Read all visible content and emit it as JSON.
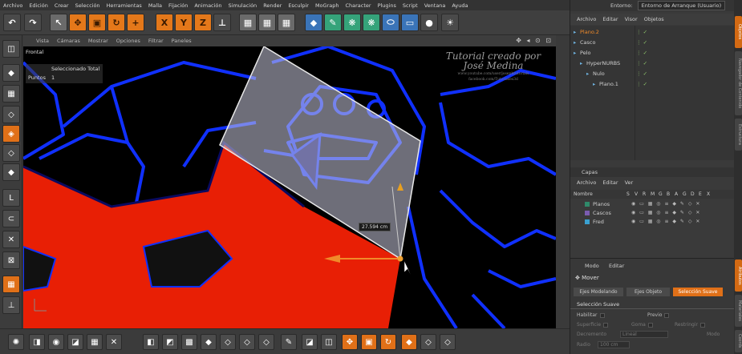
{
  "menubar": [
    "Archivo",
    "Edición",
    "Crear",
    "Selección",
    "Herramientas",
    "Malla",
    "Fijación",
    "Animación",
    "Simulación",
    "Render",
    "Esculpir",
    "MoGraph",
    "Character",
    "Plugins",
    "Script",
    "Ventana",
    "Ayuda"
  ],
  "toolbar": {
    "axis_x": "X",
    "axis_y": "Y",
    "axis_z": "Z"
  },
  "viewport": {
    "menu": [
      "Vista",
      "Cámaras",
      "Mostrar",
      "Opciones",
      "Filtrar",
      "Paneles"
    ],
    "view_name": "Frontal",
    "hud_title": "Seleccionado Total",
    "hud_label": "Puntos",
    "hud_value": "1",
    "watermark_line1": "Tutorial creado por",
    "watermark_line2": "José Medina",
    "watermark_line3": "www.youtube.com/user/josephtutorials",
    "watermark_line4": "facebook.com/Tutoriales3d",
    "measure": "27.594 cm"
  },
  "entorno": {
    "label": "Entorno:",
    "value": "Entorno de Arranque (Usuario)"
  },
  "objects": {
    "menu": [
      "Archivo",
      "Editar",
      "Visor",
      "Objetos"
    ],
    "rows": [
      {
        "name": "Plano.2",
        "indent": 0,
        "selected": true
      },
      {
        "name": "Casco",
        "indent": 0,
        "selected": false
      },
      {
        "name": "Pelo",
        "indent": 0,
        "selected": false
      },
      {
        "name": "HyperNURBS",
        "indent": 1,
        "selected": false
      },
      {
        "name": "Nulo",
        "indent": 2,
        "selected": false
      },
      {
        "name": "Plano.1",
        "indent": 3,
        "selected": false
      }
    ]
  },
  "layers": {
    "title": "Capas",
    "menu": [
      "Archivo",
      "Editar",
      "Ver"
    ],
    "columns": [
      "Nombre",
      "S",
      "V",
      "R",
      "M",
      "G",
      "B",
      "A",
      "G",
      "D",
      "E",
      "X"
    ],
    "rows": [
      {
        "name": "Planos",
        "color": "#2f8a6a"
      },
      {
        "name": "Cascos",
        "color": "#7a5cb0"
      },
      {
        "name": "Fred",
        "color": "#3aa0d0"
      }
    ]
  },
  "attributes": {
    "menu": [
      "Modo",
      "Editar"
    ],
    "mode_title": "Mover",
    "tabs": [
      "Ejes Modelando",
      "Ejes Objeto",
      "Selección Suave"
    ],
    "section": "Selección Suave",
    "fields": {
      "habilitar": "Habilitar",
      "previo": "Previo",
      "superficie": "Superficie",
      "goma": "Goma",
      "restringir": "Restringir",
      "decremento": "Decremento",
      "decremento_value": "Lineal",
      "modo": "Modo",
      "radio": "Radio",
      "radio_value": "100 cm"
    }
  },
  "sidetabs": [
    "Objetos",
    "Navegador de Contenido",
    "Estructura",
    "Atributos",
    "Materiales",
    "Coords"
  ]
}
